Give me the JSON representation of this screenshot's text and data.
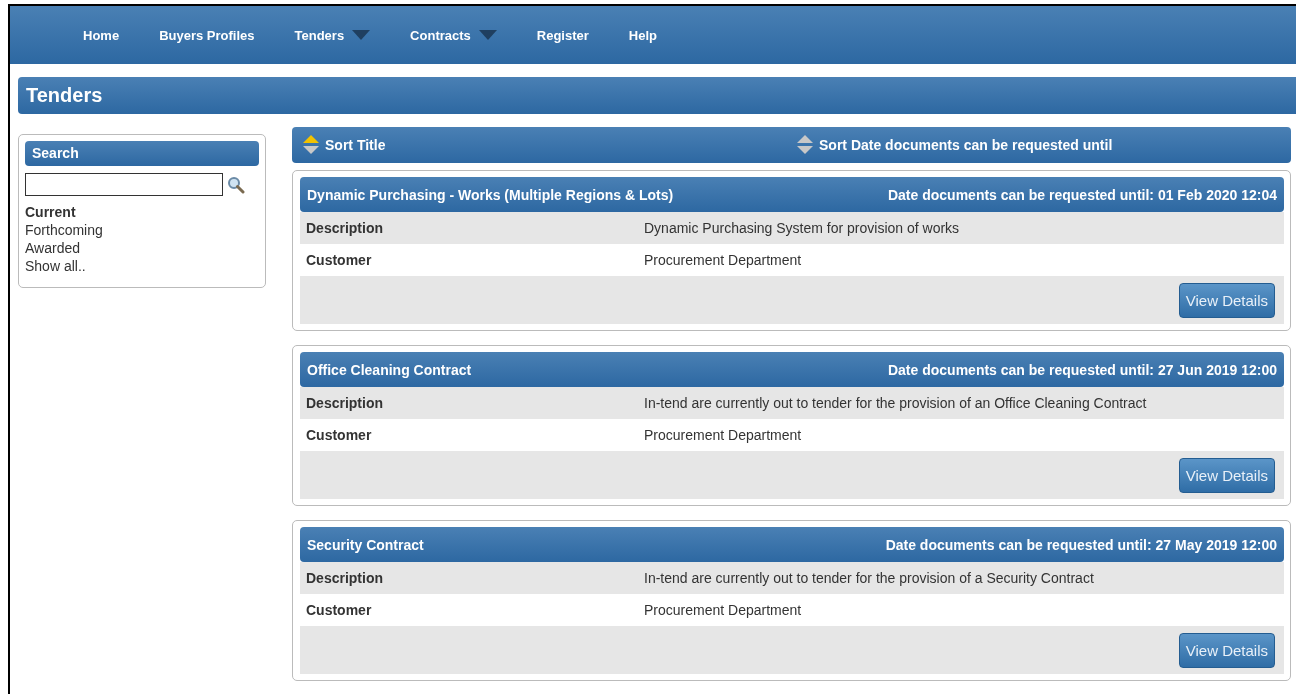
{
  "nav": [
    {
      "label": "Home",
      "dropdown": false
    },
    {
      "label": "Buyers Profiles",
      "dropdown": false
    },
    {
      "label": "Tenders",
      "dropdown": true
    },
    {
      "label": "Contracts",
      "dropdown": true
    },
    {
      "label": "Register",
      "dropdown": false
    },
    {
      "label": "Help",
      "dropdown": false
    }
  ],
  "page_title": "Tenders",
  "search": {
    "title": "Search",
    "filters": [
      {
        "label": "Current",
        "selected": true
      },
      {
        "label": "Forthcoming",
        "selected": false
      },
      {
        "label": "Awarded",
        "selected": false
      },
      {
        "label": "Show all..",
        "selected": false
      }
    ]
  },
  "sort": [
    {
      "label": "Sort Title",
      "active": true
    },
    {
      "label": "Sort Date documents can be requested until",
      "active": false
    }
  ],
  "tenders": [
    {
      "title": "Dynamic Purchasing - Works (Multiple Regions & Lots)",
      "deadline": "Date documents can be requested until: 01 Feb 2020 12:04",
      "fields": [
        {
          "label": "Description",
          "value": "Dynamic Purchasing System for provision of works"
        },
        {
          "label": "Customer",
          "value": "Procurement Department"
        }
      ],
      "button": "View Details"
    },
    {
      "title": "Office Cleaning Contract",
      "deadline": "Date documents can be requested until: 27 Jun 2019 12:00",
      "fields": [
        {
          "label": "Description",
          "value": "In-tend are currently out to tender for the provision of an Office Cleaning Contract"
        },
        {
          "label": "Customer",
          "value": "Procurement Department"
        }
      ],
      "button": "View Details"
    },
    {
      "title": "Security Contract",
      "deadline": "Date documents can be requested until: 27 May 2019 12:00",
      "fields": [
        {
          "label": "Description",
          "value": "In-tend are currently out to tender for the provision of a Security Contract"
        },
        {
          "label": "Customer",
          "value": "Procurement Department"
        }
      ],
      "button": "View Details"
    }
  ]
}
